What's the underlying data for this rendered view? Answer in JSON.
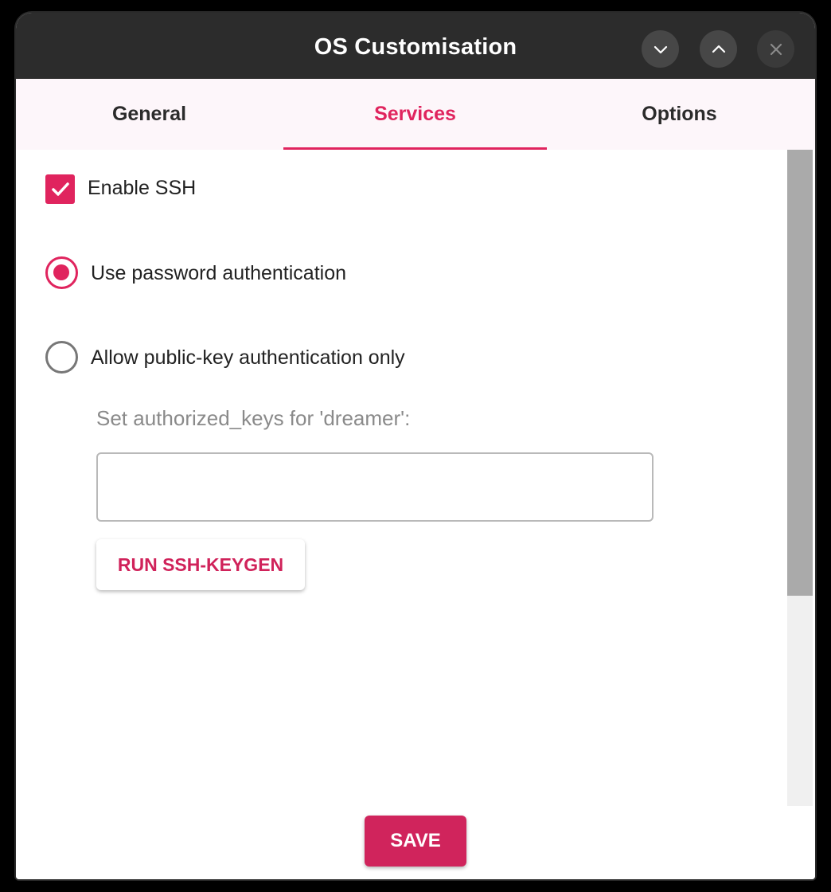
{
  "window": {
    "title": "OS Customisation"
  },
  "tabs": [
    {
      "label": "General",
      "active": false
    },
    {
      "label": "Services",
      "active": true
    },
    {
      "label": "Options",
      "active": false
    }
  ],
  "services": {
    "enable_ssh": {
      "label": "Enable SSH",
      "checked": true
    },
    "auth_options": [
      {
        "label": "Use password authentication",
        "selected": true
      },
      {
        "label": "Allow public-key authentication only",
        "selected": false
      }
    ],
    "authorized_keys": {
      "label": "Set authorized_keys for 'dreamer':",
      "value": ""
    },
    "keygen_button": "RUN SSH-KEYGEN"
  },
  "footer": {
    "save_label": "SAVE"
  },
  "colors": {
    "accent": "#e0245e",
    "titlebar": "#2c2c2c",
    "tab_bar": "#fdf6fa"
  },
  "icons": {
    "minimize": "chevron-down-icon",
    "maximize": "chevron-up-icon",
    "close": "close-icon",
    "checkbox": "checkmark-icon"
  }
}
